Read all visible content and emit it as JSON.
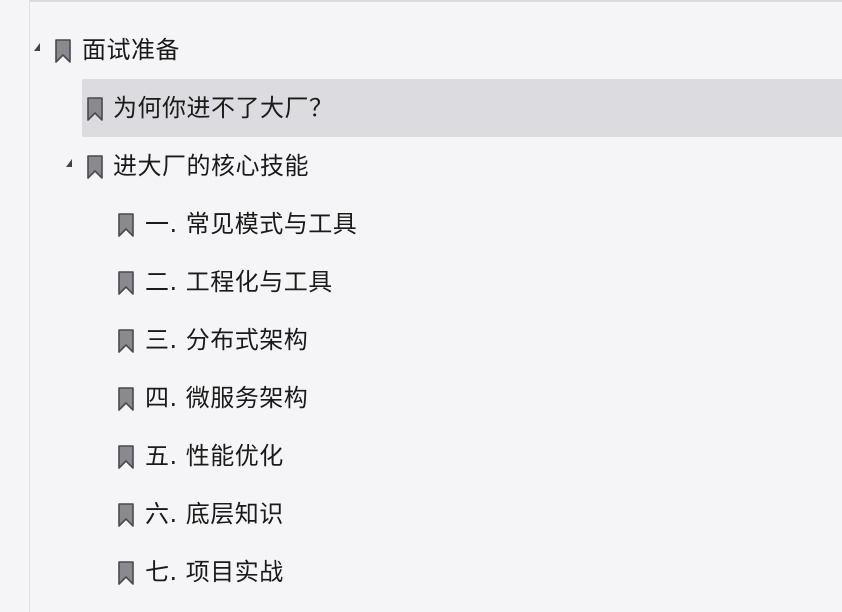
{
  "outline": {
    "items": [
      {
        "label": "面试准备",
        "level": 0,
        "expanded": true,
        "selected": false
      },
      {
        "label": "为何你进不了大厂？",
        "level": 1,
        "expanded": null,
        "selected": true
      },
      {
        "label": "进大厂的核心技能",
        "level": 1,
        "expanded": true,
        "selected": false
      },
      {
        "label": "一. 常见模式与工具",
        "level": 2,
        "expanded": null,
        "selected": false
      },
      {
        "label": "二. 工程化与工具",
        "level": 2,
        "expanded": null,
        "selected": false
      },
      {
        "label": "三. 分布式架构",
        "level": 2,
        "expanded": null,
        "selected": false
      },
      {
        "label": "四. 微服务架构",
        "level": 2,
        "expanded": null,
        "selected": false
      },
      {
        "label": "五. 性能优化",
        "level": 2,
        "expanded": null,
        "selected": false
      },
      {
        "label": "六. 底层知识",
        "level": 2,
        "expanded": null,
        "selected": false
      },
      {
        "label": "七. 项目实战",
        "level": 2,
        "expanded": null,
        "selected": false
      }
    ]
  },
  "colors": {
    "background": "#f5f5f7",
    "selected": "#dcdce0",
    "bookmark_fill": "#8a8a8e",
    "bookmark_stroke": "#4a4a4e"
  },
  "icons": {
    "bookmark": "bookmark-icon",
    "expanded_toggle": "triangle-expanded-icon"
  }
}
